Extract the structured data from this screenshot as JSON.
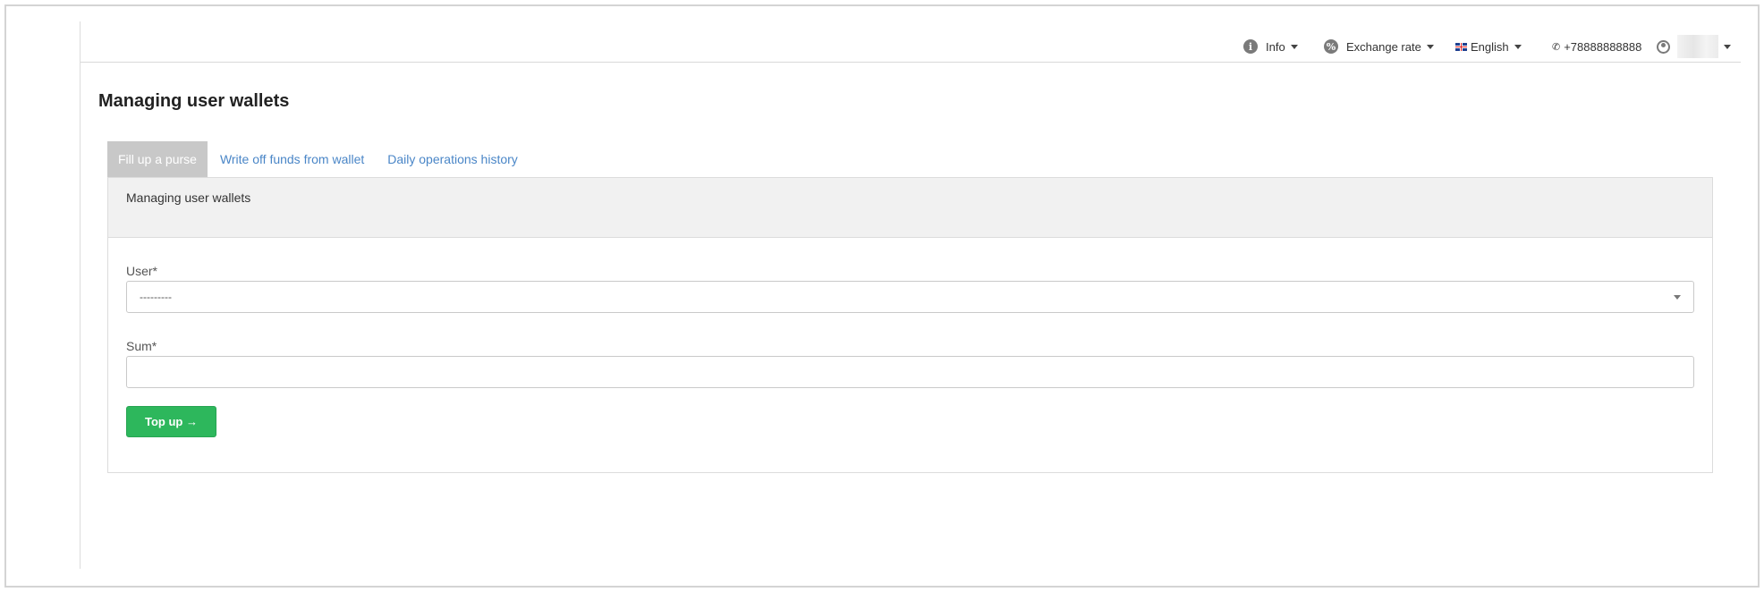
{
  "topbar": {
    "info_label": "Info",
    "exchange_label": "Exchange rate",
    "language_label": "English",
    "phone": "+78888888888"
  },
  "page": {
    "title": "Managing user wallets"
  },
  "tabs": [
    {
      "label": "Fill up a purse",
      "active": true
    },
    {
      "label": "Write off funds from wallet",
      "active": false
    },
    {
      "label": "Daily operations history",
      "active": false
    }
  ],
  "card": {
    "header": "Managing user wallets",
    "user_label": "User*",
    "user_selected": "---------",
    "sum_label": "Sum*",
    "sum_value": "",
    "submit_label": "Top up →"
  },
  "colors": {
    "accent_link": "#4a86c7",
    "primary_button": "#2db75c",
    "active_tab_bg": "#c8c8c8"
  }
}
